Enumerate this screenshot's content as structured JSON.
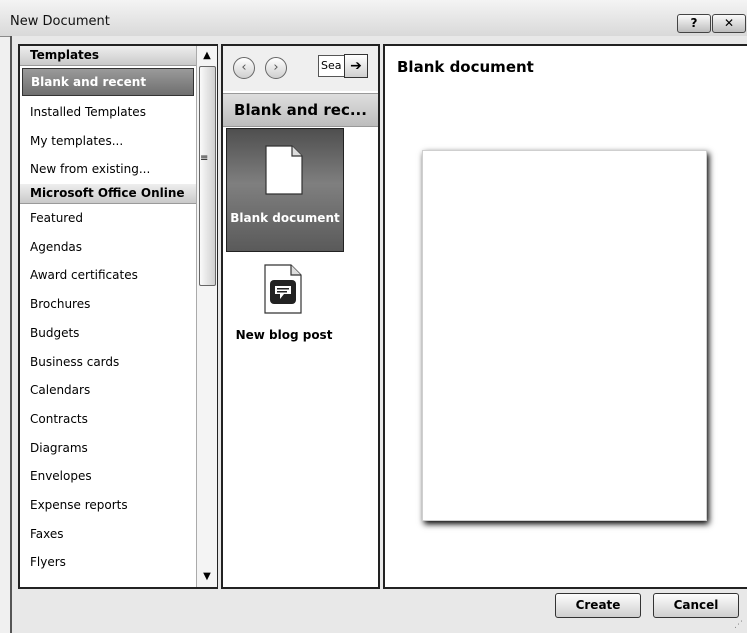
{
  "window": {
    "title": "New Document",
    "help_label": "?",
    "close_label": "✕"
  },
  "left_panel": {
    "header_templates": "Templates",
    "templates_items": [
      {
        "label": "Blank and recent",
        "selected": true
      },
      {
        "label": "Installed Templates"
      },
      {
        "label": "My templates..."
      },
      {
        "label": "New from existing..."
      }
    ],
    "header_online": "Microsoft Office Online",
    "online_items": [
      {
        "label": "Featured"
      },
      {
        "label": "Agendas"
      },
      {
        "label": "Award certificates"
      },
      {
        "label": "Brochures"
      },
      {
        "label": "Budgets"
      },
      {
        "label": "Business cards"
      },
      {
        "label": "Calendars"
      },
      {
        "label": "Contracts"
      },
      {
        "label": "Diagrams"
      },
      {
        "label": "Envelopes"
      },
      {
        "label": "Expense reports"
      },
      {
        "label": "Faxes"
      },
      {
        "label": "Flyers"
      }
    ]
  },
  "middle_panel": {
    "back_icon": "‹",
    "forward_icon": "›",
    "search_text": "Sea",
    "search_go_icon": "➔",
    "section_heading": "Blank and rec...",
    "tiles": [
      {
        "label": "Blank document",
        "icon": "blank-document-icon",
        "selected": true
      },
      {
        "label": "New blog post",
        "icon": "blog-post-icon"
      }
    ]
  },
  "preview": {
    "title": "Blank document"
  },
  "buttons": {
    "create": "Create",
    "cancel": "Cancel"
  }
}
